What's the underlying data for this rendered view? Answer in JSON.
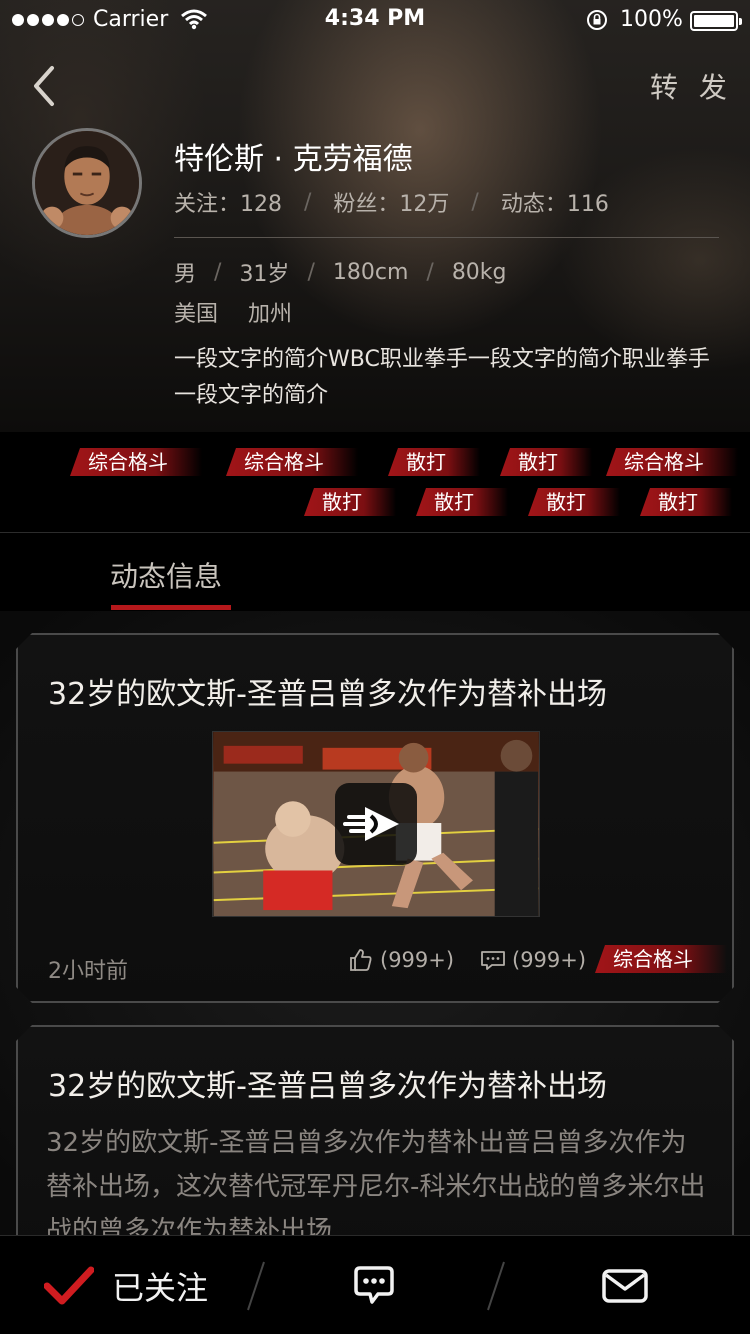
{
  "status_bar": {
    "carrier": "Carrier",
    "time": "4:34 PM",
    "battery": "100%"
  },
  "header": {
    "forward": "转 发"
  },
  "profile": {
    "name": "特伦斯 · 克劳福德",
    "stats": {
      "follow": "关注：128",
      "fans": "粉丝：12万",
      "posts": "动态：116"
    },
    "gender": "男",
    "age": "31岁",
    "height": "180cm",
    "weight": "80kg",
    "country": "美国",
    "region": "加州",
    "intro": "一段文字的简介WBC职业拳手一段文字的简介职业拳手一段文字的简介"
  },
  "tags": [
    "综合格斗",
    "综合格斗",
    "散打",
    "散打",
    "综合格斗",
    "散打",
    "散打",
    "散打",
    "散打"
  ],
  "tab": {
    "label": "动态信息"
  },
  "feed": [
    {
      "title": "32岁的欧文斯-圣普吕曾多次作为替补出场",
      "time": "2小时前",
      "likes": "(999+)",
      "comments": "(999+)",
      "tag": "综合格斗"
    },
    {
      "title": "32岁的欧文斯-圣普吕曾多次作为替补出场",
      "body": "32岁的欧文斯-圣普吕曾多次作为替补出普吕曾多次作为替补出场，这次替代冠军丹尼尔-科米尔出战的曾多米尔出战的曾多次作为替补出场..."
    }
  ],
  "bottom_bar": {
    "follow_label": "已关注"
  },
  "colors": {
    "accent_red": "#b5181b",
    "background": "#050505"
  }
}
